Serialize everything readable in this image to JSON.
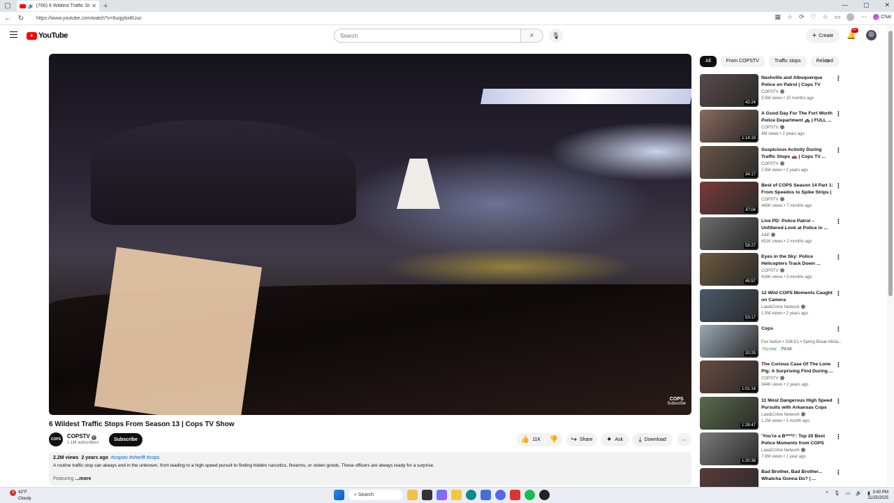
{
  "browser": {
    "tab_title": "(766) 6 Wildest Traffic Stops...",
    "url": "https://www.youtube.com/watch?v=6uqjybxBUuc",
    "chat_label": "Chat"
  },
  "header": {
    "logo_text": "YouTube",
    "search_placeholder": "Search",
    "create_label": "Create",
    "notif_count": "9+"
  },
  "video": {
    "title": "6 Wildest Traffic Stops From Season 13 | Cops TV Show",
    "watermark_brand": "COPS",
    "watermark_sub": "Subscribe"
  },
  "channel": {
    "avatar_text": "COPS",
    "name": "COPSTV",
    "subscribers": "1.1M subscribers",
    "subscribe_label": "Subscribe"
  },
  "actions": {
    "likes": "11K",
    "share": "Share",
    "ask": "Ask",
    "download": "Download"
  },
  "description": {
    "views": "2.2M views",
    "age": "2 years ago",
    "tags": "#copstv #sheriff #cops",
    "text": "A routine traffic stop can always end in the unknown, from leading to a high-speed pursuit to finding hidden narcotics, firearms, or stolen goods. These officers are always ready for a surprise.",
    "more_prefix": "Featuring",
    "more_label": "...more"
  },
  "chips": [
    "All",
    "From COPSTV",
    "Traffic stops",
    "Related"
  ],
  "related": [
    {
      "title": "Nashville and Albuquerque Police on Patrol | Cops TV Show",
      "channel": "COPSTV",
      "verified": true,
      "meta": "3.5M views • 10 months ago",
      "duration": "42:24",
      "thumb": "#5a4a4a"
    },
    {
      "title": "A Good Day For The Fort Worth Police Department 🚓 | FULL ...",
      "channel": "COPSTV",
      "verified": true,
      "meta": "4M views • 2 years ago",
      "duration": "1:14:19",
      "thumb": "#8a6a5e"
    },
    {
      "title": "Suspicious Activity During Traffic Stops 🚗 | Cops TV ...",
      "channel": "COPSTV",
      "verified": true,
      "meta": "2.5M views • 2 years ago",
      "duration": "34:17",
      "thumb": "#6a5548"
    },
    {
      "title": "Best of COPS Season 14 Part 1: From Speedos to Spike Strips | ...",
      "channel": "COPSTV",
      "verified": true,
      "meta": "445K views • 7 months ago",
      "duration": "47:04",
      "thumb": "#7a3a3a"
    },
    {
      "title": "Live PD: Police Patrol – Unfiltered Look at Police in ...",
      "channel": "A&E",
      "verified": true,
      "meta": "651K views • 2 months ago",
      "duration": "58:27",
      "thumb": "#6c6c6c"
    },
    {
      "title": "Eyes in the Sky: Police Helicopters Track Down ...",
      "channel": "COPSTV",
      "verified": true,
      "meta": "416K views • 3 months ago",
      "duration": "45:57",
      "thumb": "#6e5a3e"
    },
    {
      "title": "12 Wild COPS Moments Caught on Camera",
      "channel": "Law&Crime Network",
      "verified": true,
      "meta": "1.5M views • 2 years ago",
      "duration": "53:17",
      "thumb": "#4a5a6a"
    },
    {
      "title": "Cops",
      "channel": "Fox Nation • S36 E1 • Spring Break Mista...",
      "verified": false,
      "meta": "",
      "badge1": "Try now",
      "badge2": "TV-14",
      "duration": "20:25",
      "thumb": "#9aa8b4"
    },
    {
      "title": "The Curious Case Of The Lone Pig: A Surprising Find During ...",
      "channel": "COPSTV",
      "verified": true,
      "meta": "344K views • 2 years ago",
      "duration": "1:01:16",
      "thumb": "#6a4a40"
    },
    {
      "title": "11 Most Dangerous High Speed Pursuits with Arkansas Cops",
      "channel": "Law&Crime Network",
      "verified": true,
      "meta": "1.2M views • 1 month ago",
      "duration": "1:28:47",
      "thumb": "#5a6a4a"
    },
    {
      "title": "'You're a B****!': Top 20 Best Police Moments from COPS",
      "channel": "Law&Crime Network",
      "verified": true,
      "meta": "7.8M views • 1 year ago",
      "duration": "1:20:38",
      "thumb": "#7a7a7a"
    },
    {
      "title": "Bad Brother, Bad Brother... Whatcha Gonna Do? | ...",
      "channel": "",
      "verified": false,
      "meta": "",
      "duration": "",
      "thumb": "#5a3a3a"
    }
  ],
  "taskbar": {
    "temperature": "42°F",
    "condition": "Cloudy",
    "alert_count": "3",
    "search_label": "Search",
    "time": "3:40 PM",
    "date": "11/25/2025"
  },
  "colors": {
    "brand_red": "#ff0000",
    "link_blue": "#065fd4"
  }
}
